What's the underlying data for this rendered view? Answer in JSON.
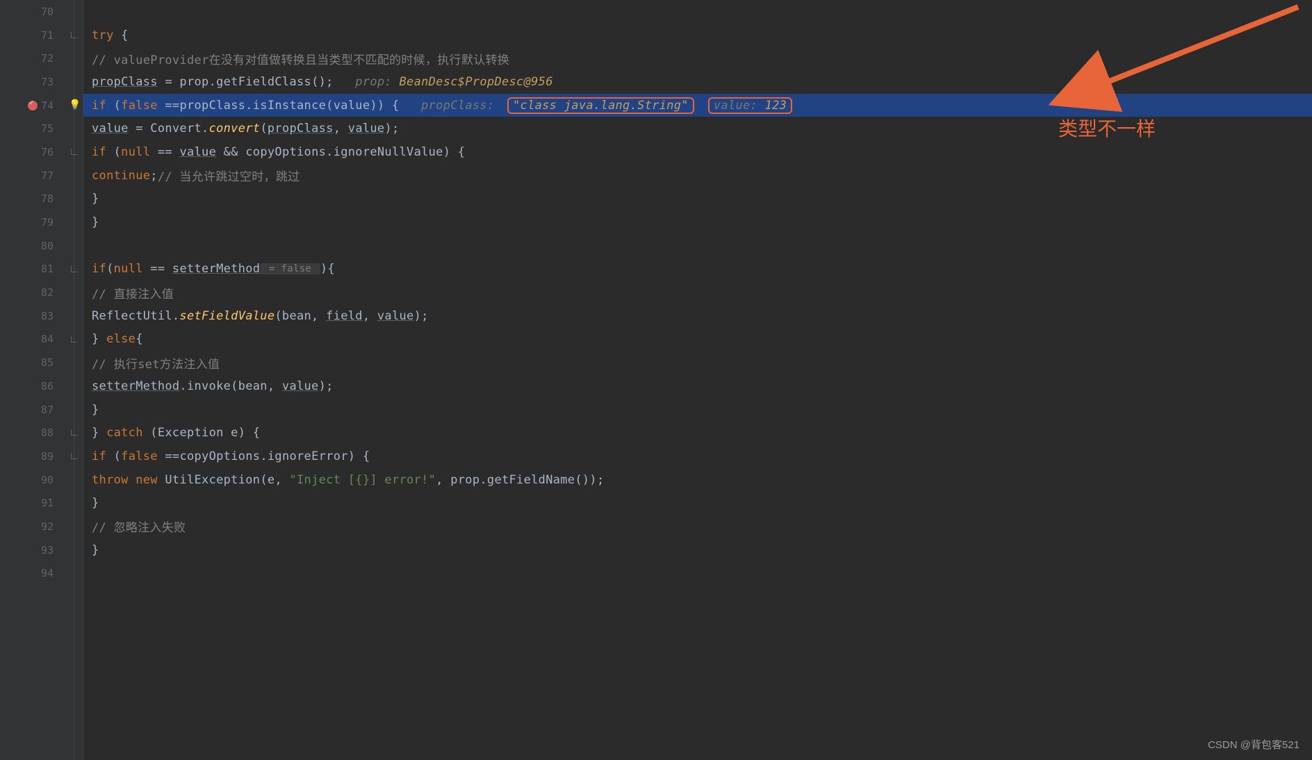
{
  "lines": {
    "start": 70,
    "end": 94,
    "breakpoint_line": 74
  },
  "code": {
    "l70": "",
    "l71_try": "try",
    "l71_brace": " {",
    "l72_comment": "// valueProvider在没有对值做转换且当类型不匹配的时候，执行默认转换",
    "l73_propClass": "propClass",
    "l73_eq": " = prop.",
    "l73_getFieldClass": "getFieldClass",
    "l73_paren": "();   ",
    "l73_hint_label": "prop: ",
    "l73_hint_val": "BeanDesc$PropDesc@956",
    "l74_if": "if",
    "l74_open": " (",
    "l74_false": "false",
    "l74_eqeq": " ==propClass.",
    "l74_isInstance": "isInstance",
    "l74_args": "(value)) {   ",
    "l74_hint1_label": "propClass: ",
    "l74_hint1_val": "\"class java.lang.String\"",
    "l74_hint2_label": "value: ",
    "l74_hint2_val": "123",
    "l75_value": "value",
    "l75_eq": " = Convert.",
    "l75_convert": "convert",
    "l75_open": "(",
    "l75_arg1": "propClass",
    "l75_comma": ", ",
    "l75_arg2": "value",
    "l75_close": ");",
    "l76_if": "if",
    "l76_open": " (",
    "l76_null": "null",
    "l76_eqeq": " == ",
    "l76_value": "value",
    "l76_and": " && copyOptions.",
    "l76_ignore": "ignoreNullValue",
    "l76_close": ") {",
    "l77_continue": "continue",
    "l77_semi": ";",
    "l77_comment": "// 当允许跳过空时，跳过",
    "l78": "}",
    "l79": "}",
    "l80": "",
    "l81_if": "if",
    "l81_open": "(",
    "l81_null": "null",
    "l81_eqeq": " == ",
    "l81_setter": "setterMethod",
    "l81_hint": " = false ",
    "l81_close": "){",
    "l82_comment": "// 直接注入值",
    "l83_reflect": "ReflectUtil.",
    "l83_setfield": "setFieldValue",
    "l83_args_open": "(bean, ",
    "l83_field": "field",
    "l83_comma": ", ",
    "l83_value": "value",
    "l83_close": ");",
    "l84_close": "} ",
    "l84_else": "else",
    "l84_brace": "{",
    "l85_comment": "// 执行set方法注入值",
    "l86_setter": "setterMethod",
    "l86_invoke": ".invoke(bean, ",
    "l86_value": "value",
    "l86_close": ");",
    "l87": "}",
    "l88_close": "} ",
    "l88_catch": "catch",
    "l88_args": " (Exception e) {",
    "l89_if": "if",
    "l89_open": " (",
    "l89_false": "false",
    "l89_rest": " ==copyOptions.",
    "l89_ignore": "ignoreError",
    "l89_close": ") {",
    "l90_throw": "throw new",
    "l90_exc": " UtilException(e, ",
    "l90_str": "\"Inject [{}] error!\"",
    "l90_rest": ", prop.getFieldName());",
    "l91": "}",
    "l92_comment": "// 忽略注入失败",
    "l93": "}",
    "l94": ""
  },
  "annotation": {
    "text": "类型不一样"
  },
  "watermark": "CSDN @背包客521"
}
